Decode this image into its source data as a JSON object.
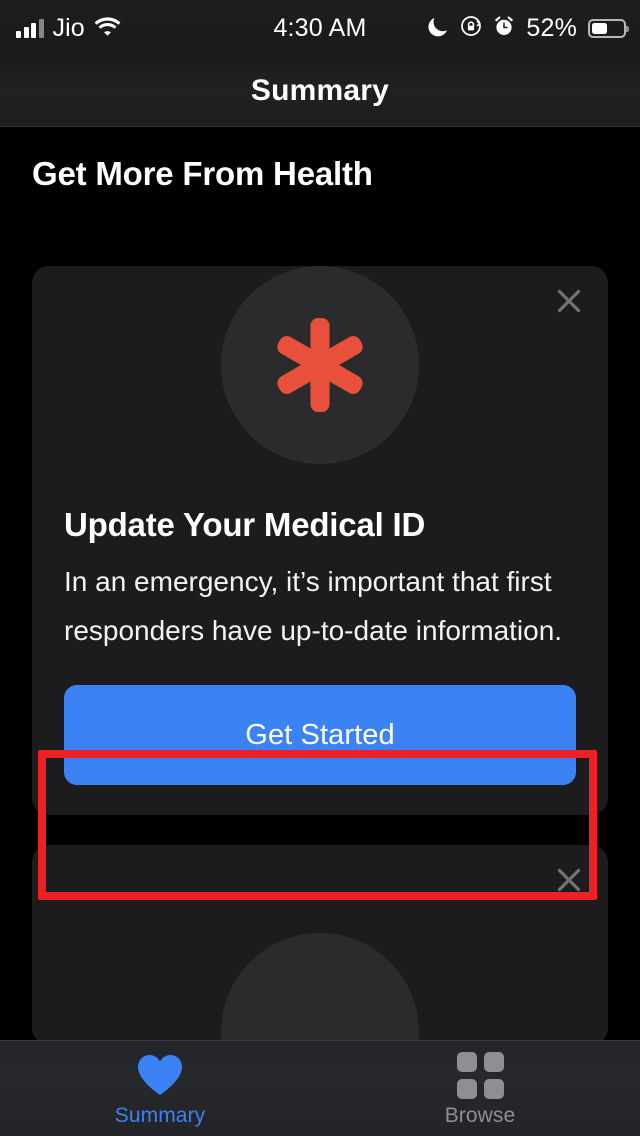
{
  "status_bar": {
    "carrier": "Jio",
    "time": "4:30 AM",
    "battery_percent": "52%",
    "icons": [
      "cellular-signal-icon",
      "wifi-icon",
      "moon-icon",
      "rotation-lock-icon",
      "alarm-icon",
      "battery-icon"
    ]
  },
  "nav": {
    "title": "Summary"
  },
  "main": {
    "section_title": "Get More From Health",
    "cards": [
      {
        "icon": "medical-id-asterisk-icon",
        "title": "Update Your Medical ID",
        "body": "In an emergency, it’s important that first responders have up-to-date information.",
        "cta_label": "Get Started",
        "close_label": "×"
      },
      {
        "icon": "partial-card-icon",
        "close_label": "×"
      }
    ]
  },
  "annotation": {
    "target": "get-started-button",
    "color": "#ed2024"
  },
  "tab_bar": {
    "tabs": [
      {
        "label": "Summary",
        "icon": "heart-icon",
        "active": true
      },
      {
        "label": "Browse",
        "icon": "grid-icon",
        "active": false
      }
    ]
  },
  "colors": {
    "accent_blue": "#3b82f4",
    "medical_red": "#e9503c",
    "card_bg": "#1c1c1e",
    "page_bg": "#000000",
    "inactive_gray": "#8e8e93"
  }
}
